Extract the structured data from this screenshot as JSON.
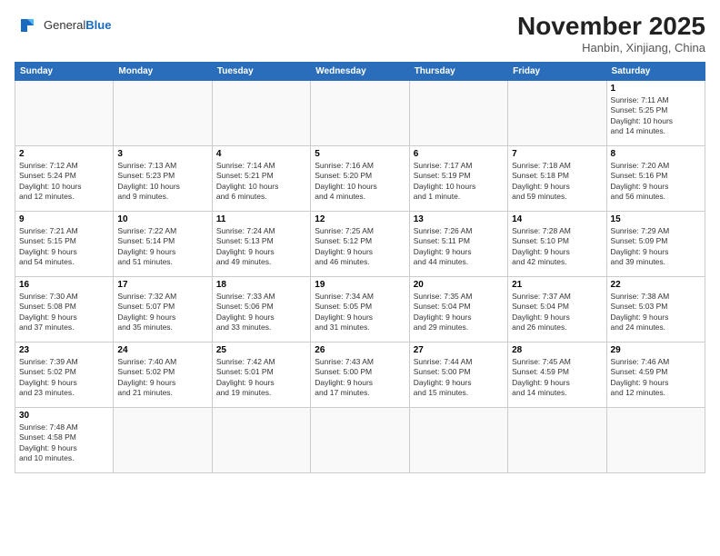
{
  "header": {
    "logo_general": "General",
    "logo_blue": "Blue",
    "month": "November 2025",
    "location": "Hanbin, Xinjiang, China"
  },
  "days_of_week": [
    "Sunday",
    "Monday",
    "Tuesday",
    "Wednesday",
    "Thursday",
    "Friday",
    "Saturday"
  ],
  "weeks": [
    [
      {
        "day": "",
        "info": ""
      },
      {
        "day": "",
        "info": ""
      },
      {
        "day": "",
        "info": ""
      },
      {
        "day": "",
        "info": ""
      },
      {
        "day": "",
        "info": ""
      },
      {
        "day": "",
        "info": ""
      },
      {
        "day": "1",
        "info": "Sunrise: 7:11 AM\nSunset: 5:25 PM\nDaylight: 10 hours\nand 14 minutes."
      }
    ],
    [
      {
        "day": "2",
        "info": "Sunrise: 7:12 AM\nSunset: 5:24 PM\nDaylight: 10 hours\nand 12 minutes."
      },
      {
        "day": "3",
        "info": "Sunrise: 7:13 AM\nSunset: 5:23 PM\nDaylight: 10 hours\nand 9 minutes."
      },
      {
        "day": "4",
        "info": "Sunrise: 7:14 AM\nSunset: 5:21 PM\nDaylight: 10 hours\nand 6 minutes."
      },
      {
        "day": "5",
        "info": "Sunrise: 7:16 AM\nSunset: 5:20 PM\nDaylight: 10 hours\nand 4 minutes."
      },
      {
        "day": "6",
        "info": "Sunrise: 7:17 AM\nSunset: 5:19 PM\nDaylight: 10 hours\nand 1 minute."
      },
      {
        "day": "7",
        "info": "Sunrise: 7:18 AM\nSunset: 5:18 PM\nDaylight: 9 hours\nand 59 minutes."
      },
      {
        "day": "8",
        "info": "Sunrise: 7:20 AM\nSunset: 5:16 PM\nDaylight: 9 hours\nand 56 minutes."
      }
    ],
    [
      {
        "day": "9",
        "info": "Sunrise: 7:21 AM\nSunset: 5:15 PM\nDaylight: 9 hours\nand 54 minutes."
      },
      {
        "day": "10",
        "info": "Sunrise: 7:22 AM\nSunset: 5:14 PM\nDaylight: 9 hours\nand 51 minutes."
      },
      {
        "day": "11",
        "info": "Sunrise: 7:24 AM\nSunset: 5:13 PM\nDaylight: 9 hours\nand 49 minutes."
      },
      {
        "day": "12",
        "info": "Sunrise: 7:25 AM\nSunset: 5:12 PM\nDaylight: 9 hours\nand 46 minutes."
      },
      {
        "day": "13",
        "info": "Sunrise: 7:26 AM\nSunset: 5:11 PM\nDaylight: 9 hours\nand 44 minutes."
      },
      {
        "day": "14",
        "info": "Sunrise: 7:28 AM\nSunset: 5:10 PM\nDaylight: 9 hours\nand 42 minutes."
      },
      {
        "day": "15",
        "info": "Sunrise: 7:29 AM\nSunset: 5:09 PM\nDaylight: 9 hours\nand 39 minutes."
      }
    ],
    [
      {
        "day": "16",
        "info": "Sunrise: 7:30 AM\nSunset: 5:08 PM\nDaylight: 9 hours\nand 37 minutes."
      },
      {
        "day": "17",
        "info": "Sunrise: 7:32 AM\nSunset: 5:07 PM\nDaylight: 9 hours\nand 35 minutes."
      },
      {
        "day": "18",
        "info": "Sunrise: 7:33 AM\nSunset: 5:06 PM\nDaylight: 9 hours\nand 33 minutes."
      },
      {
        "day": "19",
        "info": "Sunrise: 7:34 AM\nSunset: 5:05 PM\nDaylight: 9 hours\nand 31 minutes."
      },
      {
        "day": "20",
        "info": "Sunrise: 7:35 AM\nSunset: 5:04 PM\nDaylight: 9 hours\nand 29 minutes."
      },
      {
        "day": "21",
        "info": "Sunrise: 7:37 AM\nSunset: 5:04 PM\nDaylight: 9 hours\nand 26 minutes."
      },
      {
        "day": "22",
        "info": "Sunrise: 7:38 AM\nSunset: 5:03 PM\nDaylight: 9 hours\nand 24 minutes."
      }
    ],
    [
      {
        "day": "23",
        "info": "Sunrise: 7:39 AM\nSunset: 5:02 PM\nDaylight: 9 hours\nand 23 minutes."
      },
      {
        "day": "24",
        "info": "Sunrise: 7:40 AM\nSunset: 5:02 PM\nDaylight: 9 hours\nand 21 minutes."
      },
      {
        "day": "25",
        "info": "Sunrise: 7:42 AM\nSunset: 5:01 PM\nDaylight: 9 hours\nand 19 minutes."
      },
      {
        "day": "26",
        "info": "Sunrise: 7:43 AM\nSunset: 5:00 PM\nDaylight: 9 hours\nand 17 minutes."
      },
      {
        "day": "27",
        "info": "Sunrise: 7:44 AM\nSunset: 5:00 PM\nDaylight: 9 hours\nand 15 minutes."
      },
      {
        "day": "28",
        "info": "Sunrise: 7:45 AM\nSunset: 4:59 PM\nDaylight: 9 hours\nand 14 minutes."
      },
      {
        "day": "29",
        "info": "Sunrise: 7:46 AM\nSunset: 4:59 PM\nDaylight: 9 hours\nand 12 minutes."
      }
    ],
    [
      {
        "day": "30",
        "info": "Sunrise: 7:48 AM\nSunset: 4:58 PM\nDaylight: 9 hours\nand 10 minutes."
      },
      {
        "day": "",
        "info": ""
      },
      {
        "day": "",
        "info": ""
      },
      {
        "day": "",
        "info": ""
      },
      {
        "day": "",
        "info": ""
      },
      {
        "day": "",
        "info": ""
      },
      {
        "day": "",
        "info": ""
      }
    ]
  ]
}
